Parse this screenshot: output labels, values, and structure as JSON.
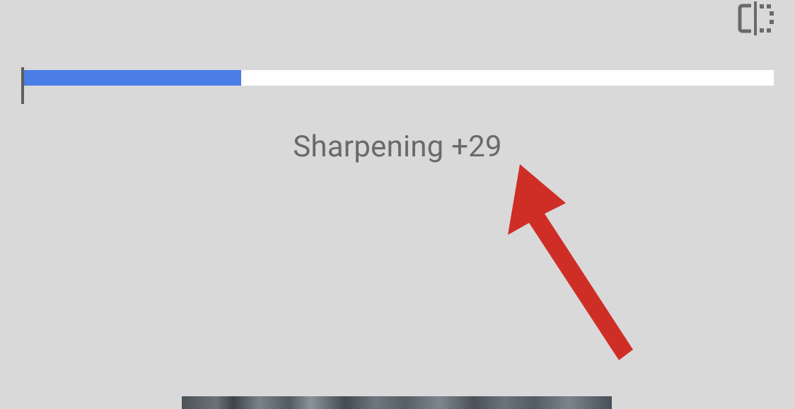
{
  "slider": {
    "label": "Sharpening +29",
    "fill_percent": 29
  },
  "colors": {
    "fill": "#4b7de6",
    "track": "#ffffff",
    "tick": "#5e5e5e",
    "annotation": "#cf2e26"
  }
}
